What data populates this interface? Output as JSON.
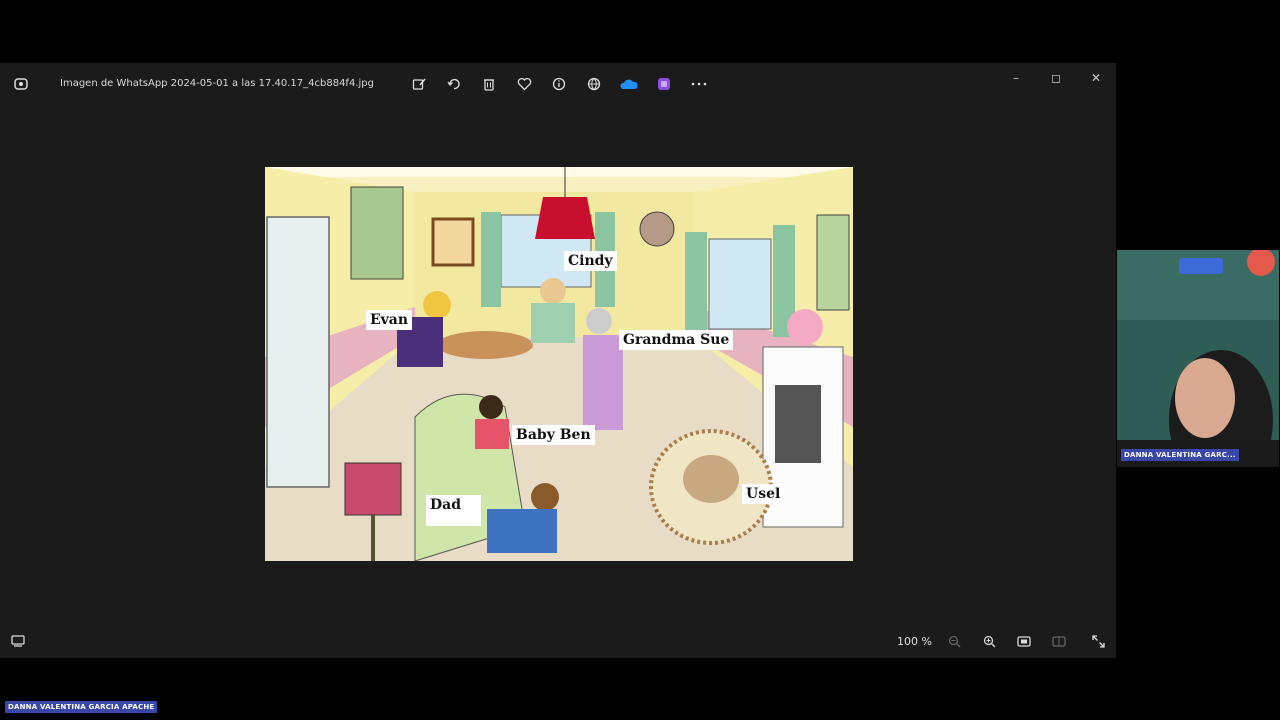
{
  "window": {
    "title": "Imagen de WhatsApp 2024-05-01 a las 17.40.17_4cb884f4.jpg",
    "toolbar_icons": [
      "edit-image-icon",
      "rotate-icon",
      "delete-icon",
      "favorite-icon",
      "info-icon",
      "share-icon",
      "onedrive-icon",
      "clipchamp-icon",
      "more-icon"
    ],
    "window_controls": {
      "minimize": "–",
      "maximize": "◻",
      "close": "✕"
    }
  },
  "scene": {
    "labels": {
      "cindy": "Cindy",
      "evan": "Evan",
      "grandma_sue": "Grandma Sue",
      "baby_ben": "Baby Ben",
      "dad": "Dad",
      "usel": "Usel"
    }
  },
  "bottombar": {
    "zoom": "100 %"
  },
  "webcam": {
    "participant_name": "DANNA VALENTINA GARC..."
  },
  "footer": {
    "participant_name": "DANNA VALENTINA GARCIA APACHE"
  },
  "colors": {
    "accent": "#3a46a8",
    "viewer_bg": "#1b1b1c",
    "onedrive": "#1f8ff5",
    "clipchamp": "#8a4fe0"
  }
}
